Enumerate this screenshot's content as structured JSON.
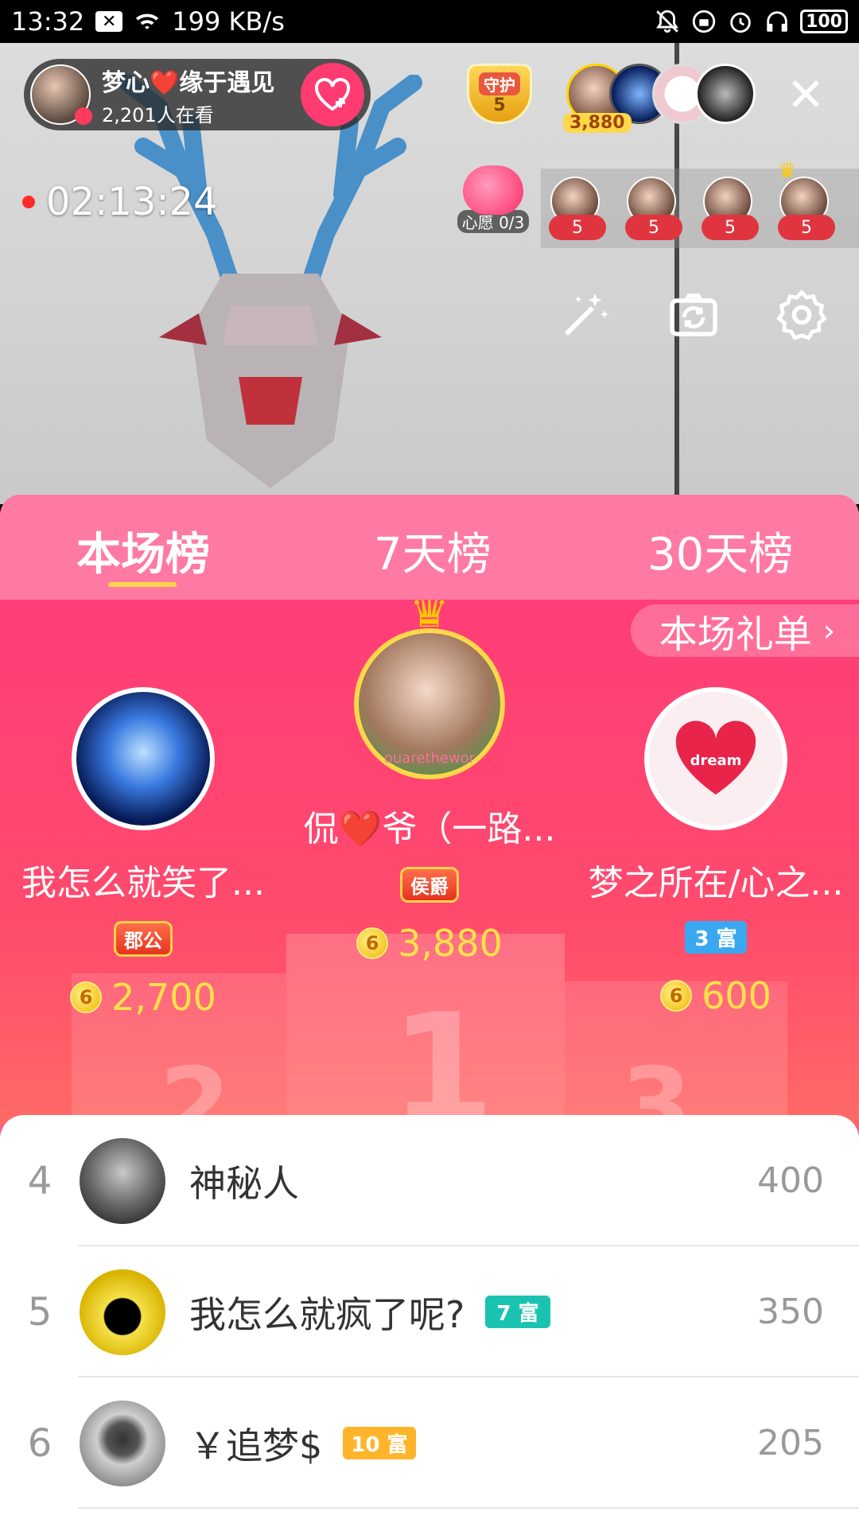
{
  "status_bar": {
    "time": "13:32",
    "notif_icon": "x-icon",
    "network_speed": "199 KB/s",
    "battery": "100"
  },
  "live": {
    "host_name": "梦心❤️缘于遇见",
    "viewers": "2,201人在看",
    "timer": "02:13:24",
    "guard_label": "守护",
    "guard_count": "5",
    "top_contribution": "3,880",
    "wish_label": "心愿 0/3",
    "fan_levels": [
      "5",
      "5",
      "5",
      "5"
    ]
  },
  "tabs": {
    "current": "本场榜",
    "week": "7天榜",
    "month": "30天榜"
  },
  "gift_list_label": "本场礼单",
  "podium": {
    "first": {
      "name": "侃❤️爷（一路...",
      "title": "侯爵",
      "coins": "3,880",
      "avatar_text": "ouarethewor"
    },
    "second": {
      "name": "我怎么就笑了...",
      "title": "郡公",
      "coins": "2,700"
    },
    "third": {
      "name": "梦之所在/心之...",
      "rich": "3 富",
      "coins": "600",
      "avatar_text": "dream"
    },
    "coin_symbol": "6",
    "pedestal_numbers": [
      "2",
      "1",
      "3"
    ]
  },
  "ranking_list": [
    {
      "rank": "4",
      "name": "神秘人",
      "chip": "",
      "amount": "400"
    },
    {
      "rank": "5",
      "name": "我怎么就疯了呢?",
      "chip": "7 富",
      "amount": "350"
    },
    {
      "rank": "6",
      "name": "￥追梦$",
      "chip": "10 富",
      "amount": "205"
    }
  ]
}
